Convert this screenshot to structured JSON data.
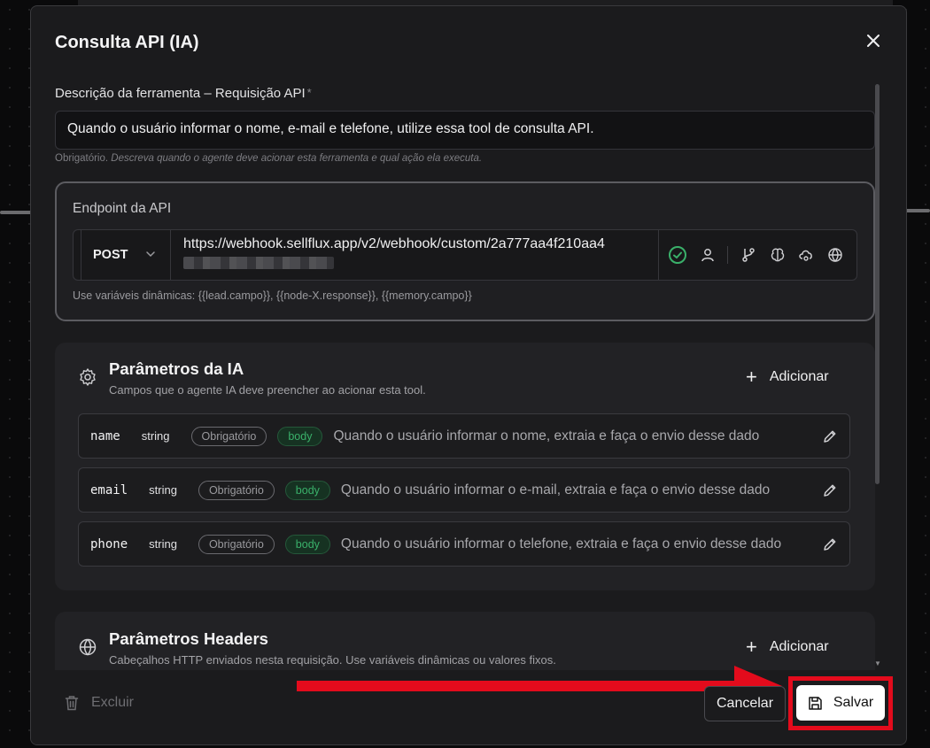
{
  "modal": {
    "title": "Consulta API (IA)",
    "description_field": {
      "label": "Descrição da ferramenta – Requisição API",
      "required_mark": "*",
      "value": "Quando o usuário informar o nome, e-mail e telefone, utilize essa tool de consulta API.",
      "help_prefix": "Obrigatório.",
      "help_text": "Descreva quando o agente deve acionar esta ferramenta e qual ação ela executa."
    },
    "endpoint": {
      "title": "Endpoint da API",
      "method": "POST",
      "url": "https://webhook.sellflux.app/v2/webhook/custom/2a777aa4f210aa4",
      "help": "Use variáveis dinâmicas: {{lead.campo}}, {{node-X.response}}, {{memory.campo}}",
      "icons": [
        "check-circle-icon",
        "user-icon",
        "git-branch-icon",
        "brain-icon",
        "cloud-icon",
        "globe-icon"
      ]
    },
    "ai_params": {
      "title": "Parâmetros da IA",
      "subtitle": "Campos que o agente IA deve preencher ao acionar esta tool.",
      "add_label": "Adicionar",
      "rows": [
        {
          "name": "name",
          "type": "string",
          "required": "Obrigatório",
          "location": "body",
          "description": "Quando o usuário informar o nome, extraia e faça o envio desse dado"
        },
        {
          "name": "email",
          "type": "string",
          "required": "Obrigatório",
          "location": "body",
          "description": "Quando o usuário informar o e-mail, extraia e faça o envio desse dado"
        },
        {
          "name": "phone",
          "type": "string",
          "required": "Obrigatório",
          "location": "body",
          "description": "Quando o usuário informar o telefone, extraia e faça o envio desse dado"
        }
      ]
    },
    "headers_params": {
      "title": "Parâmetros Headers",
      "subtitle": "Cabeçalhos HTTP enviados nesta requisição. Use variáveis dinâmicas ou valores fixos.",
      "add_label": "Adicionar"
    },
    "footer": {
      "delete_label": "Excluir",
      "cancel_label": "Cancelar",
      "save_label": "Salvar"
    }
  },
  "colors": {
    "accent_red": "#e30b1c",
    "success_green": "#3ab06a",
    "modal_bg": "#1b1b1d"
  }
}
